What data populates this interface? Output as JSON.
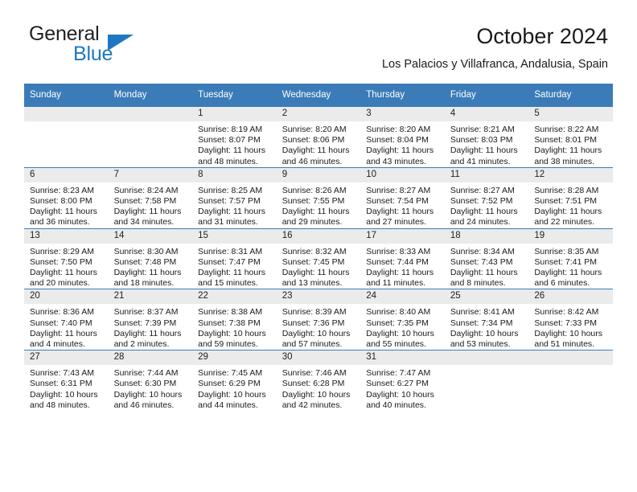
{
  "brand": {
    "word_one": "General",
    "word_two": "Blue",
    "triangle_icon": "triangle-logo-icon",
    "accent_color": "#1f76c2"
  },
  "header": {
    "title": "October 2024",
    "subtitle": "Los Palacios y Villafranca, Andalusia, Spain"
  },
  "theme": {
    "header_row_color": "#3b7cb8",
    "day_band_color": "#ebebeb",
    "text_color": "#1a1a1a"
  },
  "weekday_headers": [
    "Sunday",
    "Monday",
    "Tuesday",
    "Wednesday",
    "Thursday",
    "Friday",
    "Saturday"
  ],
  "labels": {
    "sunrise_prefix": "Sunrise:",
    "sunset_prefix": "Sunset:",
    "daylight_prefix": "Daylight:"
  },
  "weeks": [
    [
      {
        "day": "",
        "line1": "",
        "line2": "",
        "line3": "",
        "line4": ""
      },
      {
        "day": "",
        "line1": "",
        "line2": "",
        "line3": "",
        "line4": ""
      },
      {
        "day": "1",
        "line1": "Sunrise: 8:19 AM",
        "line2": "Sunset: 8:07 PM",
        "line3": "Daylight: 11 hours",
        "line4": "and 48 minutes."
      },
      {
        "day": "2",
        "line1": "Sunrise: 8:20 AM",
        "line2": "Sunset: 8:06 PM",
        "line3": "Daylight: 11 hours",
        "line4": "and 46 minutes."
      },
      {
        "day": "3",
        "line1": "Sunrise: 8:20 AM",
        "line2": "Sunset: 8:04 PM",
        "line3": "Daylight: 11 hours",
        "line4": "and 43 minutes."
      },
      {
        "day": "4",
        "line1": "Sunrise: 8:21 AM",
        "line2": "Sunset: 8:03 PM",
        "line3": "Daylight: 11 hours",
        "line4": "and 41 minutes."
      },
      {
        "day": "5",
        "line1": "Sunrise: 8:22 AM",
        "line2": "Sunset: 8:01 PM",
        "line3": "Daylight: 11 hours",
        "line4": "and 38 minutes."
      }
    ],
    [
      {
        "day": "6",
        "line1": "Sunrise: 8:23 AM",
        "line2": "Sunset: 8:00 PM",
        "line3": "Daylight: 11 hours",
        "line4": "and 36 minutes."
      },
      {
        "day": "7",
        "line1": "Sunrise: 8:24 AM",
        "line2": "Sunset: 7:58 PM",
        "line3": "Daylight: 11 hours",
        "line4": "and 34 minutes."
      },
      {
        "day": "8",
        "line1": "Sunrise: 8:25 AM",
        "line2": "Sunset: 7:57 PM",
        "line3": "Daylight: 11 hours",
        "line4": "and 31 minutes."
      },
      {
        "day": "9",
        "line1": "Sunrise: 8:26 AM",
        "line2": "Sunset: 7:55 PM",
        "line3": "Daylight: 11 hours",
        "line4": "and 29 minutes."
      },
      {
        "day": "10",
        "line1": "Sunrise: 8:27 AM",
        "line2": "Sunset: 7:54 PM",
        "line3": "Daylight: 11 hours",
        "line4": "and 27 minutes."
      },
      {
        "day": "11",
        "line1": "Sunrise: 8:27 AM",
        "line2": "Sunset: 7:52 PM",
        "line3": "Daylight: 11 hours",
        "line4": "and 24 minutes."
      },
      {
        "day": "12",
        "line1": "Sunrise: 8:28 AM",
        "line2": "Sunset: 7:51 PM",
        "line3": "Daylight: 11 hours",
        "line4": "and 22 minutes."
      }
    ],
    [
      {
        "day": "13",
        "line1": "Sunrise: 8:29 AM",
        "line2": "Sunset: 7:50 PM",
        "line3": "Daylight: 11 hours",
        "line4": "and 20 minutes."
      },
      {
        "day": "14",
        "line1": "Sunrise: 8:30 AM",
        "line2": "Sunset: 7:48 PM",
        "line3": "Daylight: 11 hours",
        "line4": "and 18 minutes."
      },
      {
        "day": "15",
        "line1": "Sunrise: 8:31 AM",
        "line2": "Sunset: 7:47 PM",
        "line3": "Daylight: 11 hours",
        "line4": "and 15 minutes."
      },
      {
        "day": "16",
        "line1": "Sunrise: 8:32 AM",
        "line2": "Sunset: 7:45 PM",
        "line3": "Daylight: 11 hours",
        "line4": "and 13 minutes."
      },
      {
        "day": "17",
        "line1": "Sunrise: 8:33 AM",
        "line2": "Sunset: 7:44 PM",
        "line3": "Daylight: 11 hours",
        "line4": "and 11 minutes."
      },
      {
        "day": "18",
        "line1": "Sunrise: 8:34 AM",
        "line2": "Sunset: 7:43 PM",
        "line3": "Daylight: 11 hours",
        "line4": "and 8 minutes."
      },
      {
        "day": "19",
        "line1": "Sunrise: 8:35 AM",
        "line2": "Sunset: 7:41 PM",
        "line3": "Daylight: 11 hours",
        "line4": "and 6 minutes."
      }
    ],
    [
      {
        "day": "20",
        "line1": "Sunrise: 8:36 AM",
        "line2": "Sunset: 7:40 PM",
        "line3": "Daylight: 11 hours",
        "line4": "and 4 minutes."
      },
      {
        "day": "21",
        "line1": "Sunrise: 8:37 AM",
        "line2": "Sunset: 7:39 PM",
        "line3": "Daylight: 11 hours",
        "line4": "and 2 minutes."
      },
      {
        "day": "22",
        "line1": "Sunrise: 8:38 AM",
        "line2": "Sunset: 7:38 PM",
        "line3": "Daylight: 10 hours",
        "line4": "and 59 minutes."
      },
      {
        "day": "23",
        "line1": "Sunrise: 8:39 AM",
        "line2": "Sunset: 7:36 PM",
        "line3": "Daylight: 10 hours",
        "line4": "and 57 minutes."
      },
      {
        "day": "24",
        "line1": "Sunrise: 8:40 AM",
        "line2": "Sunset: 7:35 PM",
        "line3": "Daylight: 10 hours",
        "line4": "and 55 minutes."
      },
      {
        "day": "25",
        "line1": "Sunrise: 8:41 AM",
        "line2": "Sunset: 7:34 PM",
        "line3": "Daylight: 10 hours",
        "line4": "and 53 minutes."
      },
      {
        "day": "26",
        "line1": "Sunrise: 8:42 AM",
        "line2": "Sunset: 7:33 PM",
        "line3": "Daylight: 10 hours",
        "line4": "and 51 minutes."
      }
    ],
    [
      {
        "day": "27",
        "line1": "Sunrise: 7:43 AM",
        "line2": "Sunset: 6:31 PM",
        "line3": "Daylight: 10 hours",
        "line4": "and 48 minutes."
      },
      {
        "day": "28",
        "line1": "Sunrise: 7:44 AM",
        "line2": "Sunset: 6:30 PM",
        "line3": "Daylight: 10 hours",
        "line4": "and 46 minutes."
      },
      {
        "day": "29",
        "line1": "Sunrise: 7:45 AM",
        "line2": "Sunset: 6:29 PM",
        "line3": "Daylight: 10 hours",
        "line4": "and 44 minutes."
      },
      {
        "day": "30",
        "line1": "Sunrise: 7:46 AM",
        "line2": "Sunset: 6:28 PM",
        "line3": "Daylight: 10 hours",
        "line4": "and 42 minutes."
      },
      {
        "day": "31",
        "line1": "Sunrise: 7:47 AM",
        "line2": "Sunset: 6:27 PM",
        "line3": "Daylight: 10 hours",
        "line4": "and 40 minutes."
      },
      {
        "day": "",
        "line1": "",
        "line2": "",
        "line3": "",
        "line4": ""
      },
      {
        "day": "",
        "line1": "",
        "line2": "",
        "line3": "",
        "line4": ""
      }
    ]
  ]
}
